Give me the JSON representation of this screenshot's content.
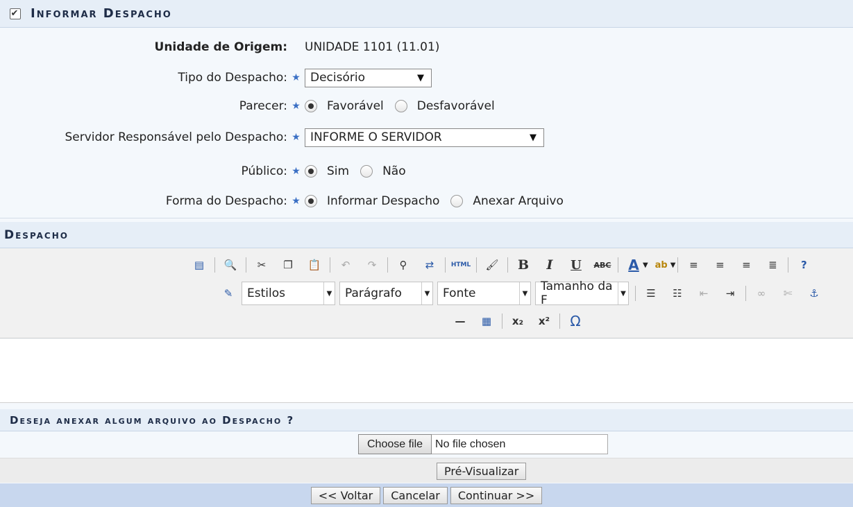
{
  "header": {
    "title": "Informar Despacho"
  },
  "form": {
    "unidade_label": "Unidade de Origem:",
    "unidade_value": "UNIDADE 1101 (11.01)",
    "tipo_label": "Tipo do Despacho:",
    "tipo_value": "Decisório",
    "parecer_label": "Parecer:",
    "parecer_opt1": "Favorável",
    "parecer_opt2": "Desfavorável",
    "parecer_selected": "Favorável",
    "servidor_label": "Servidor Responsável pelo Despacho:",
    "servidor_value": "INFORME O SERVIDOR",
    "publico_label": "Público:",
    "publico_opt1": "Sim",
    "publico_opt2": "Não",
    "publico_selected": "Sim",
    "forma_label": "Forma do Despacho:",
    "forma_opt1": "Informar Despacho",
    "forma_opt2": "Anexar Arquivo",
    "forma_selected": "Informar Despacho"
  },
  "despacho": {
    "title": "Despacho",
    "toolbar": {
      "styles": "Estilos",
      "format": "Parágrafo",
      "font": "Fonte",
      "size": "Tamanho da F",
      "html_label": "HTML",
      "bold": "B",
      "italic": "I",
      "underline": "U",
      "strike": "ABC",
      "omega": "Ω"
    }
  },
  "anexo": {
    "title": "Deseja anexar algum arquivo ao Despacho ?",
    "choose_file": "Choose file",
    "no_file": "No file chosen"
  },
  "buttons": {
    "preview": "Pré-Visualizar",
    "back": "<< Voltar",
    "cancel": "Cancelar",
    "continue": "Continuar >>"
  }
}
